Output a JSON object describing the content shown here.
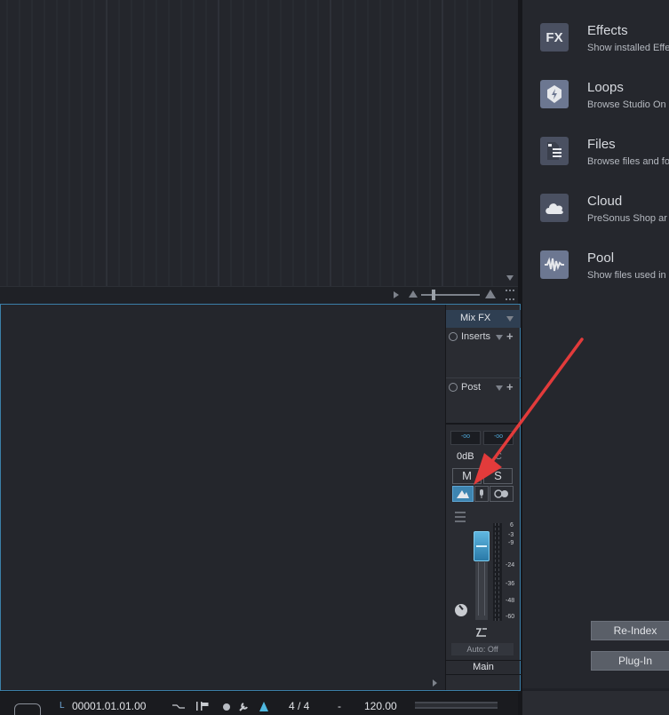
{
  "browser": {
    "items": [
      {
        "title": "Effects",
        "desc": "Show installed Effe",
        "icon": "fx-icon",
        "icon_text": "FX"
      },
      {
        "title": "Loops",
        "desc": "Browse Studio On",
        "icon": "loops-icon"
      },
      {
        "title": "Files",
        "desc": "Browse files and fo",
        "icon": "files-icon"
      },
      {
        "title": "Cloud",
        "desc": "PreSonus Shop ar",
        "icon": "cloud-icon"
      },
      {
        "title": "Pool",
        "desc": "Show files used in",
        "icon": "pool-icon"
      }
    ],
    "reindex_label": "Re-Index",
    "plugin_label": "Plug-In"
  },
  "channel": {
    "mixfx_label": "Mix FX",
    "inserts_label": "Inserts",
    "post_label": "Post",
    "meter_left": "-oo",
    "meter_right": "-oo",
    "volume": "0dB",
    "mute_label": "M",
    "solo_label": "S",
    "scale": [
      "6",
      "-3",
      "-9",
      "-24",
      "-36",
      "-48",
      "-60"
    ],
    "auto_label": "Auto: Off",
    "name": "Main"
  },
  "transport": {
    "time_prefix": "L",
    "time": "00001.01.01.00",
    "signature": "4 / 4",
    "dash": "-",
    "tempo": "120.00"
  },
  "colors": {
    "accent": "#3b7fa8",
    "annotation": "#e23b3b"
  }
}
